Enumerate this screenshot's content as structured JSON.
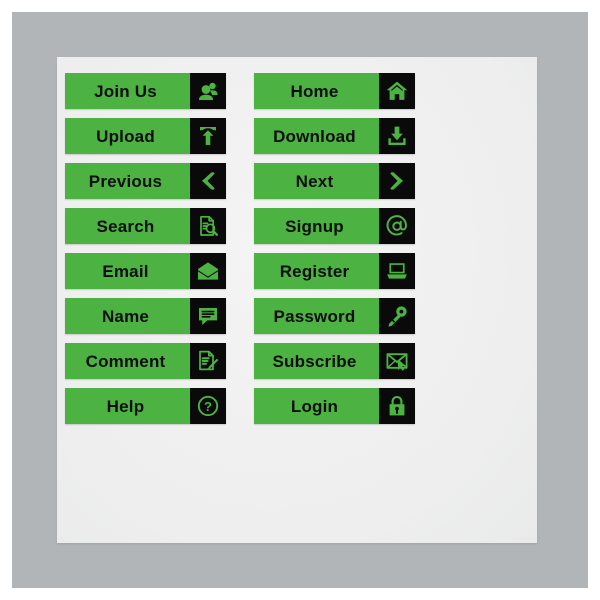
{
  "canvas": {
    "background_color": "#ffffff",
    "frame_color": "#b2b5b8",
    "card_color": "#f0f0f0",
    "button_color": "#4cb342",
    "icon_box_color": "#0a0a0a",
    "icon_glyph_color": "#4cb342",
    "label_color": "#0d0d0d"
  },
  "columns": [
    {
      "name": "left-column",
      "buttons": [
        {
          "label": "Join Us",
          "icon": "users-icon"
        },
        {
          "label": "Upload",
          "icon": "upload-arrow-icon"
        },
        {
          "label": "Previous",
          "icon": "chevron-left-icon"
        },
        {
          "label": "Search",
          "icon": "document-search-icon"
        },
        {
          "label": "Email",
          "icon": "envelope-open-icon"
        },
        {
          "label": "Name",
          "icon": "speech-bubble-icon"
        },
        {
          "label": "Comment",
          "icon": "document-pen-icon"
        },
        {
          "label": "Help",
          "icon": "question-circle-icon"
        }
      ]
    },
    {
      "name": "right-column",
      "buttons": [
        {
          "label": "Home",
          "icon": "house-icon"
        },
        {
          "label": "Download",
          "icon": "download-arrow-icon"
        },
        {
          "label": "Next",
          "icon": "chevron-right-icon"
        },
        {
          "label": "Signup",
          "icon": "at-sign-icon"
        },
        {
          "label": "Register",
          "icon": "laptop-icon"
        },
        {
          "label": "Password",
          "icon": "key-icon"
        },
        {
          "label": "Subscribe",
          "icon": "envelope-cursor-icon"
        },
        {
          "label": "Login",
          "icon": "padlock-icon"
        }
      ]
    }
  ]
}
